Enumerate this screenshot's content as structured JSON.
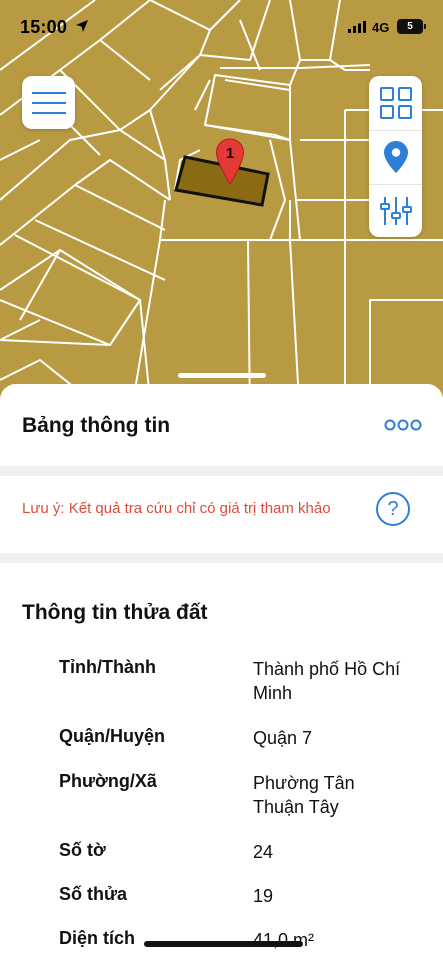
{
  "status_bar": {
    "time": "15:00",
    "network": "4G",
    "battery": "5"
  },
  "map": {
    "parcel_fill": "#b89a42",
    "highlight_fill": "#8a6a12",
    "pin_color": "#e53935",
    "pin_number": "1",
    "tools": {
      "layers_icon": "grid-icon",
      "locate_icon": "location-pin-icon",
      "filter_icon": "sliders-icon"
    }
  },
  "sheet": {
    "title": "Bảng thông tin",
    "note": "Lưu ý: Kết quả tra cứu chỉ có giá trị tham khảo",
    "help_label": "?",
    "info_title": "Thông tin thửa đất",
    "rows": [
      {
        "label": "Tỉnh/Thành",
        "value": "Thành phố Hồ Chí Minh"
      },
      {
        "label": "Quận/Huyện",
        "value": "Quận 7"
      },
      {
        "label": "Phường/Xã",
        "value": "Phường Tân Thuận Tây"
      },
      {
        "label": "Số tờ",
        "value": "24"
      },
      {
        "label": "Số thửa",
        "value": "19"
      },
      {
        "label": "Diện tích",
        "value": "41,0 m²"
      }
    ]
  },
  "colors": {
    "accent": "#2d7fd8",
    "warning_text": "#e04a3b"
  }
}
